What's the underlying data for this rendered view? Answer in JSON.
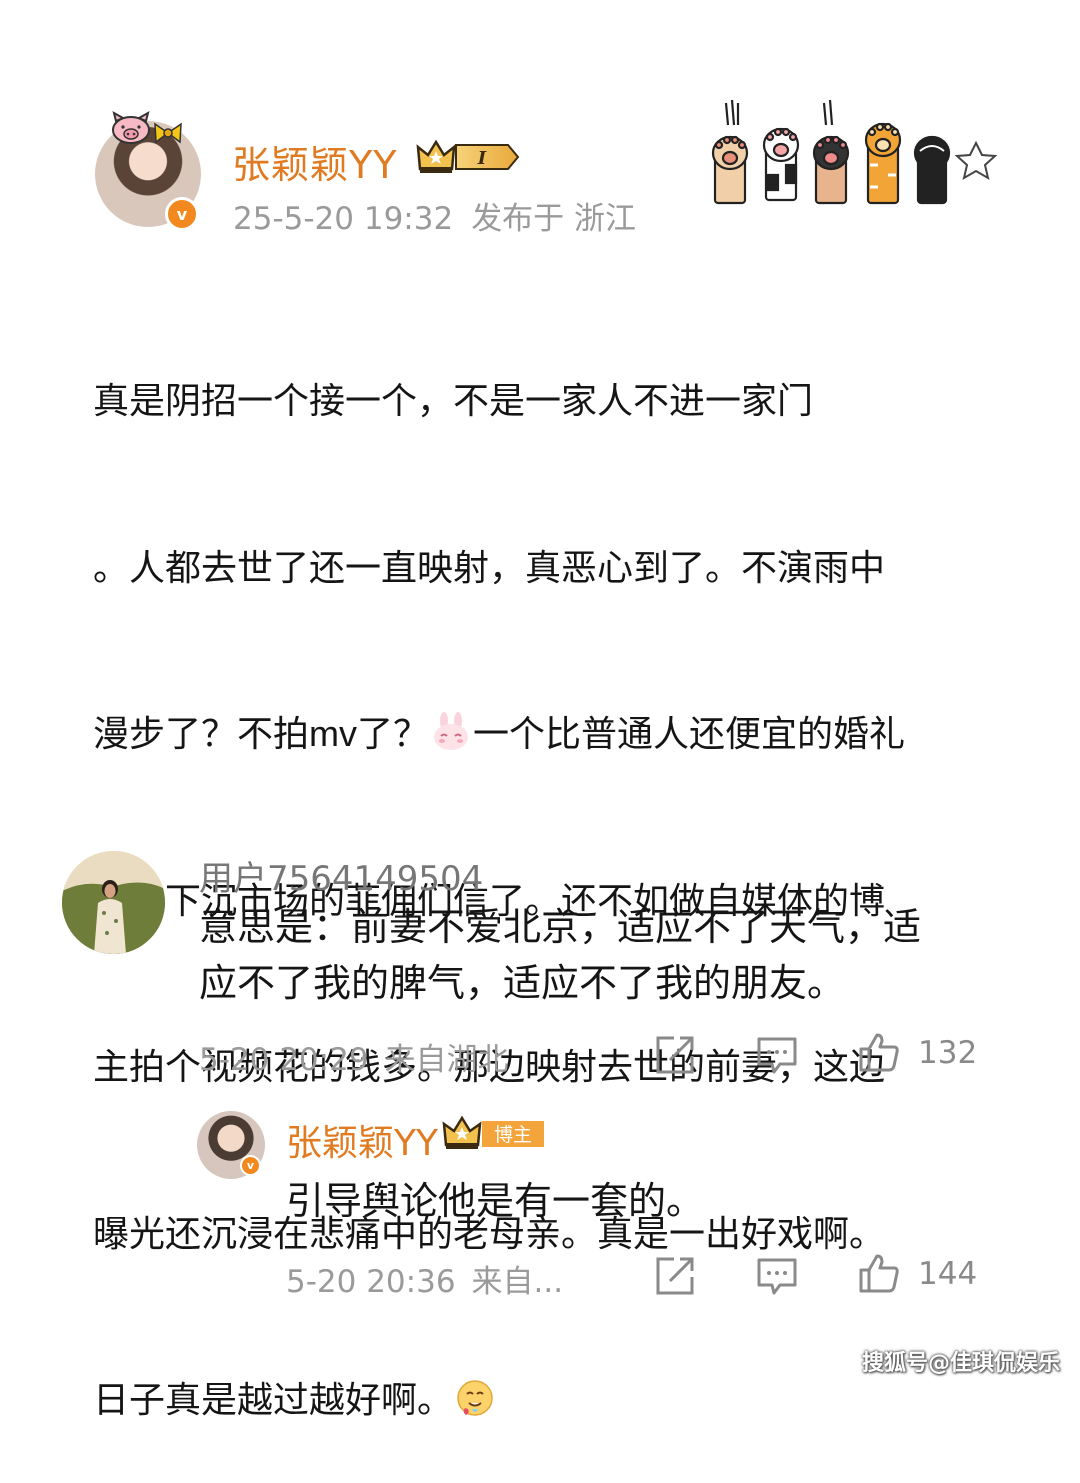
{
  "post": {
    "author": "张颖颖YY",
    "member_level": "I",
    "verified_badge": "v",
    "timestamp": "25-5-20 19:32",
    "location": "发布于 浙江",
    "body_lines": [
      "真是阴招一个接一个，不是一家人不进一家门",
      "。人都去世了还一直映射，真恶心到了。不演雨中",
      [
        "漫步了？不拍mv了？",
        "一个比普通人还便宜的婚礼"
      ],
      "也就下沉市场的菲佣们信了。还不如做自媒体的博",
      "主拍个视频花的钱多。那边映射去世的前妻，这边",
      "曝光还沉浸在悲痛中的老母亲。真是一出好戏啊。",
      "日子真是越过越好啊。"
    ],
    "emojis": [
      "bunny-emoji",
      "drooling-emoji"
    ]
  },
  "comment": {
    "user": "用户7564149504",
    "text_lines": [
      "意思是：前妻不爱北京，适应不了天气，适",
      "应不了我的脾气，适应不了我的朋友。"
    ],
    "time": "5-20 20:29",
    "location": "来自湖北",
    "likes": "132",
    "icons": [
      "share-icon",
      "comment-icon",
      "like-icon"
    ]
  },
  "reply": {
    "author": "张颖颖YY",
    "role_badge": "博主",
    "text": "引导舆论他是有一套的。",
    "time": "5-20 20:36",
    "location": "来自...",
    "likes": "144"
  },
  "watermark": "搜狐号@佳琪侃娱乐",
  "colors": {
    "accent": "#e07b22",
    "meta": "#9a9a9a",
    "badge_orange": "#f2891f"
  }
}
